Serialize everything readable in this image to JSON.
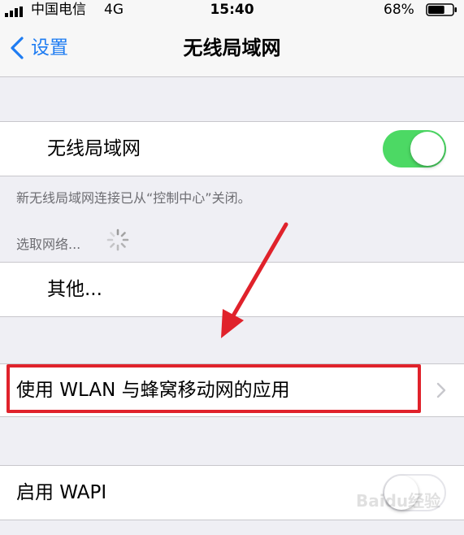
{
  "status_bar": {
    "carrier": "中国电信",
    "network": "4G",
    "time": "15:40",
    "battery": "68%",
    "battery_level": 0.68
  },
  "nav": {
    "back_label": "设置",
    "title": "无线局域网"
  },
  "wifi": {
    "label": "无线局域网",
    "enabled": true,
    "note": "新无线局域网连接已从“控制中心”关闭。"
  },
  "networks": {
    "header": "选取网络...",
    "other_label": "其他..."
  },
  "apps": {
    "label": "使用 WLAN 与蜂窝移动网的应用"
  },
  "wapi": {
    "label": "启用 WAPI",
    "enabled": false
  },
  "watermark": {
    "text": "Baidu经验"
  },
  "colors": {
    "accent": "#1e7cf2",
    "toggle_on": "#4cd964",
    "annotation": "#e0222b"
  }
}
